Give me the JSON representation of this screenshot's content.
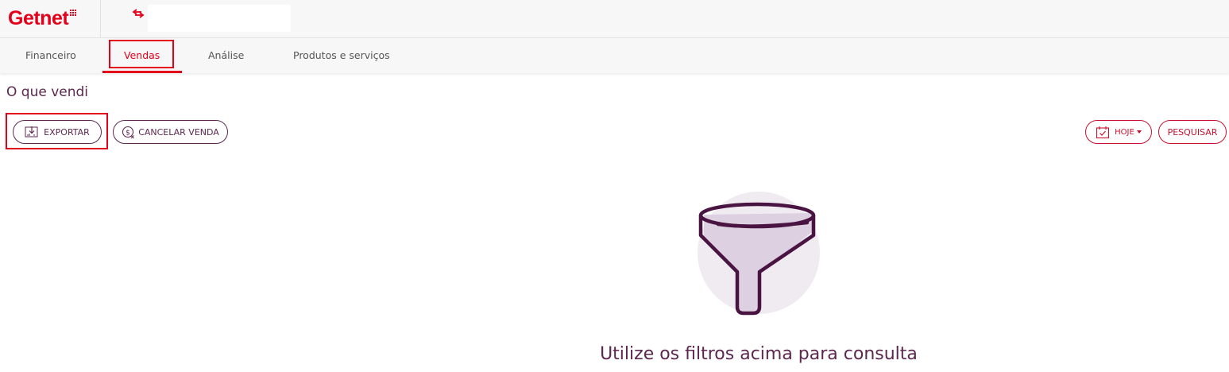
{
  "header": {
    "brand": "Getnet",
    "store_name": ""
  },
  "nav": {
    "tabs": [
      {
        "label": "Financeiro"
      },
      {
        "label": "Vendas",
        "active": true
      },
      {
        "label": "Análise"
      },
      {
        "label": "Produtos e serviços"
      }
    ]
  },
  "page": {
    "title": "O que vendi"
  },
  "actions": {
    "export_label": "EXPORTAR",
    "cancel_sale_label": "CANCELAR VENDA",
    "date_filter_label": "HOJE",
    "search_label": "PESQUISAR"
  },
  "empty_state": {
    "message": "Utilize os filtros acima para consulta",
    "icon": "funnel-icon"
  },
  "colors": {
    "brand_red": "#e2001a",
    "accent_purple": "#5e2750",
    "button_red": "#c8102e",
    "highlight": "#e2001a"
  }
}
